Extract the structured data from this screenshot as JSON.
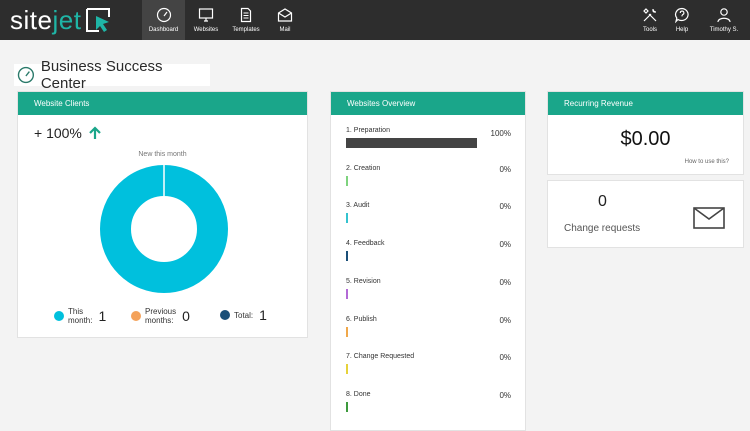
{
  "brand": {
    "site": "site",
    "jet": "jet"
  },
  "nav": [
    {
      "label": "Dashboard",
      "icon": "gauge-icon",
      "active": true
    },
    {
      "label": "Websites",
      "icon": "monitor-icon"
    },
    {
      "label": "Templates",
      "icon": "document-icon"
    },
    {
      "label": "Mail",
      "icon": "envelope-icon"
    },
    {
      "label": "Tools",
      "icon": "tools-icon"
    },
    {
      "label": "Help",
      "icon": "help-bubble-icon"
    },
    {
      "label": "Timothy S.",
      "icon": "user-icon"
    }
  ],
  "page_title": "Business Success Center",
  "clients": {
    "header": "Website Clients",
    "growth": "+ 100%",
    "new_this_month": "New this month",
    "donut": {
      "this_month": 1,
      "previous_months": 0
    },
    "legend": [
      {
        "label_line1": "This",
        "label_line2": "month:",
        "value": "1",
        "color": "#00c0dd"
      },
      {
        "label_line1": "Previous",
        "label_line2": "months:",
        "value": "0",
        "color": "#f4a25a"
      },
      {
        "label_line1": "Total:",
        "label_line2": "",
        "value": "1",
        "color": "#1a4f78"
      }
    ]
  },
  "overview": {
    "header": "Websites Overview",
    "stages": [
      {
        "name": "1. Preparation",
        "percent": "100%",
        "fraction": 1.0,
        "color": "#444444"
      },
      {
        "name": "2. Creation",
        "percent": "0%",
        "fraction": 0,
        "color": "#7ed37e"
      },
      {
        "name": "3. Audit",
        "percent": "0%",
        "fraction": 0,
        "color": "#34c3cf"
      },
      {
        "name": "4. Feedback",
        "percent": "0%",
        "fraction": 0,
        "color": "#1a4f78"
      },
      {
        "name": "5. Revision",
        "percent": "0%",
        "fraction": 0,
        "color": "#b36ad6"
      },
      {
        "name": "6. Publish",
        "percent": "0%",
        "fraction": 0,
        "color": "#f0a84a"
      },
      {
        "name": "7. Change Requested",
        "percent": "0%",
        "fraction": 0,
        "color": "#e6d23b"
      },
      {
        "name": "8. Done",
        "percent": "0%",
        "fraction": 0,
        "color": "#3d9a3d"
      }
    ]
  },
  "revenue": {
    "header": "Recurring Revenue",
    "amount": "$0.00",
    "how_to": "How to use this?"
  },
  "change_requests": {
    "count": "0",
    "label": "Change requests"
  },
  "colors": {
    "topbar": "#2d2d2d",
    "accent": "#1aa68a",
    "donut": "#00c0dd"
  }
}
